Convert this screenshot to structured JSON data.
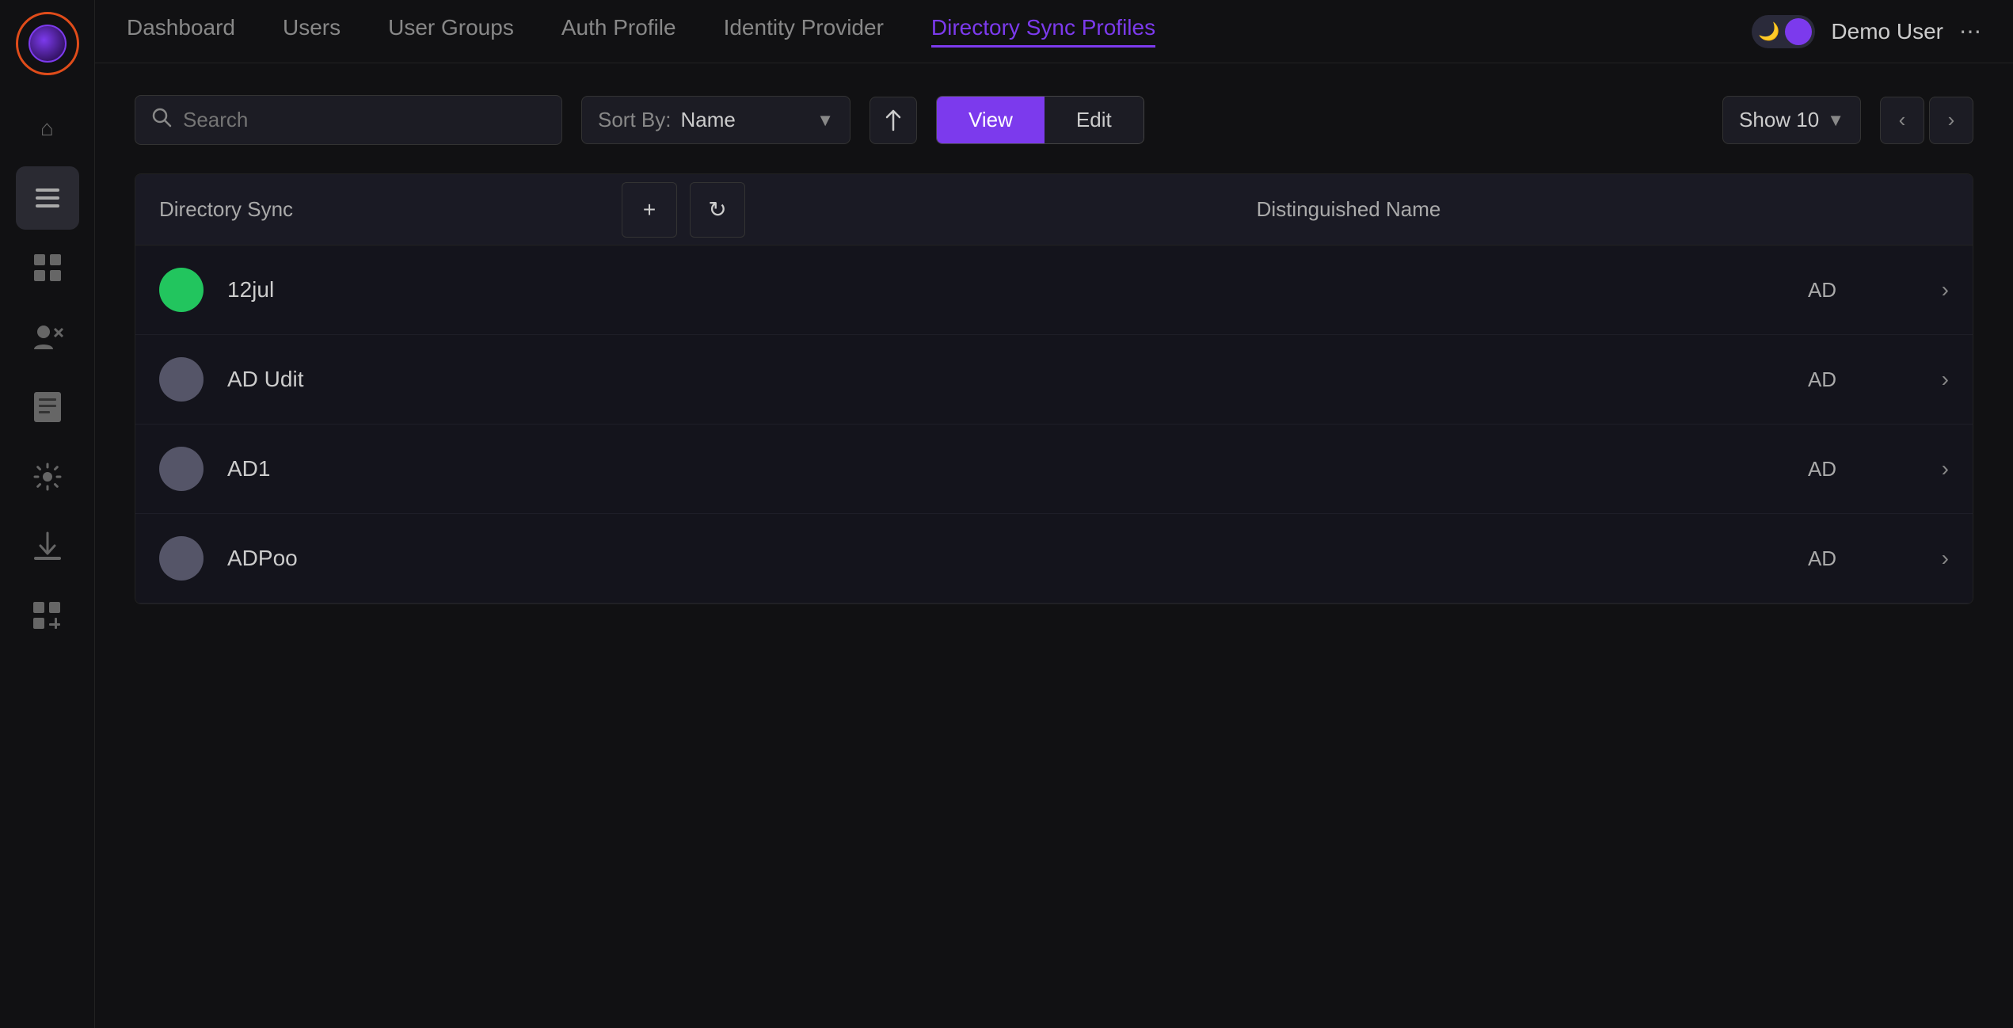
{
  "sidebar": {
    "icons": [
      {
        "name": "home-icon",
        "symbol": "⌂",
        "active": false
      },
      {
        "name": "list-icon",
        "symbol": "☰",
        "active": true
      },
      {
        "name": "grid-icon",
        "symbol": "⋮⋮",
        "active": false
      },
      {
        "name": "users-admin-icon",
        "symbol": "👤✕",
        "active": false
      },
      {
        "name": "report-icon",
        "symbol": "📋",
        "active": false
      },
      {
        "name": "settings-icon",
        "symbol": "⚙",
        "active": false
      },
      {
        "name": "download-icon",
        "symbol": "↓",
        "active": false
      },
      {
        "name": "add-widget-icon",
        "symbol": "⊞",
        "active": false
      }
    ]
  },
  "topbar": {
    "tabs": [
      {
        "label": "Dashboard",
        "active": false
      },
      {
        "label": "Users",
        "active": false
      },
      {
        "label": "User Groups",
        "active": false
      },
      {
        "label": "Auth Profile",
        "active": false
      },
      {
        "label": "Identity Provider",
        "active": false
      },
      {
        "label": "Directory Sync Profiles",
        "active": true
      }
    ],
    "user": {
      "name": "Demo User",
      "dots": "⋯"
    }
  },
  "toolbar": {
    "search_placeholder": "Search",
    "sort_by_label": "Sort By:",
    "sort_by_value": "Name",
    "view_label": "View",
    "edit_label": "Edit",
    "show_label": "Show 10"
  },
  "table": {
    "columns": {
      "dir_sync": "Directory Sync",
      "add": "+",
      "refresh": "↻",
      "distinguished_name": "Distinguished Name"
    },
    "rows": [
      {
        "name": "12jul",
        "status": "green",
        "dn": "AD"
      },
      {
        "name": "AD Udit",
        "status": "gray",
        "dn": "AD"
      },
      {
        "name": "AD1",
        "status": "gray",
        "dn": "AD"
      },
      {
        "name": "ADPoo",
        "status": "gray",
        "dn": "AD"
      }
    ]
  }
}
